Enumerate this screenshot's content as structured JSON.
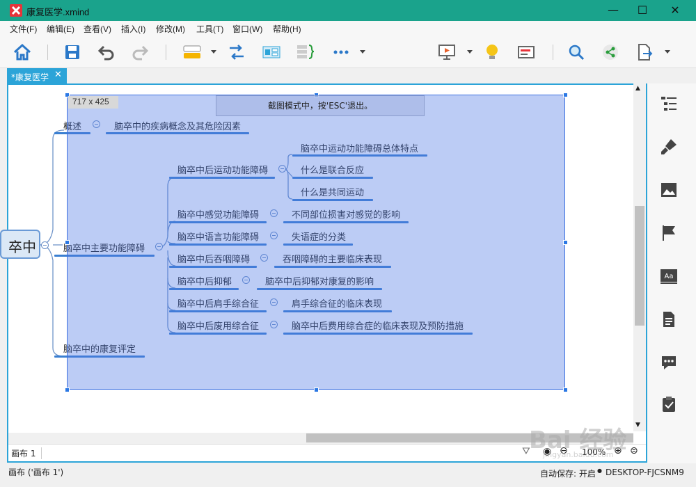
{
  "window": {
    "title": "康复医学.xmind",
    "controls": {
      "minimize": "—",
      "maximize": "☐",
      "close": "✕"
    }
  },
  "menu": [
    "文件(F)",
    "编辑(E)",
    "查看(V)",
    "插入(I)",
    "修改(M)",
    "工具(T)",
    "窗口(W)",
    "帮助(H)"
  ],
  "toolbar": {
    "icons": [
      "home-icon",
      "save-icon",
      "undo-icon",
      "redo-icon",
      "topic-icon",
      "relationship-icon",
      "boundary-icon",
      "summary-icon",
      "more-icon",
      "presentation-icon",
      "idea-icon",
      "outline-icon",
      "search-icon",
      "share-icon",
      "export-icon"
    ]
  },
  "tab": {
    "label": "*康复医学",
    "close": "✕"
  },
  "capture": {
    "size_label": "717 x 425",
    "hint": "截图模式中，按'ESC'退出。"
  },
  "mindmap": {
    "central": "卒中",
    "branch_overview": "概述",
    "overview_child": "脑卒中的疾病概念及其危险因素",
    "branch_main": "脑卒中主要功能障碍",
    "main_children": [
      {
        "label": "脑卒中后运动功能障碍",
        "children": [
          "脑卒中运动功能障碍总体特点",
          "什么是联合反应",
          "什么是共同运动"
        ]
      },
      {
        "label": "脑卒中感觉功能障碍",
        "children": [
          "不同部位损害对感觉的影响"
        ]
      },
      {
        "label": "脑卒中语言功能障碍",
        "children": [
          "失语症的分类"
        ]
      },
      {
        "label": "脑卒中后吞咽障碍",
        "children": [
          "吞咽障碍的主要临床表现"
        ]
      },
      {
        "label": "脑卒中后抑郁",
        "children": [
          "脑卒中后抑郁对康复的影响"
        ]
      },
      {
        "label": "脑卒中后肩手综合征",
        "children": [
          "肩手综合征的临床表现"
        ]
      },
      {
        "label": "脑卒中后废用综合征",
        "children": [
          "脑卒中后费用综合症的临床表现及预防措施"
        ]
      }
    ],
    "branch_eval": "脑卒中的康复评定"
  },
  "sheet": {
    "tab_label": "画布 1",
    "zoom": "100%"
  },
  "status": {
    "left": "画布 ('画布 1')",
    "autosave": "自动保存: 开启",
    "machine": "DESKTOP-FJCSNM9"
  },
  "right_panel_icons": [
    "outline-panel-icon",
    "format-icon",
    "image-icon",
    "marker-icon",
    "text-style-icon",
    "notes-icon",
    "comment-icon",
    "task-icon"
  ],
  "watermark": {
    "text": "Bai 经验",
    "sub": "jingyan.baidu.com"
  }
}
